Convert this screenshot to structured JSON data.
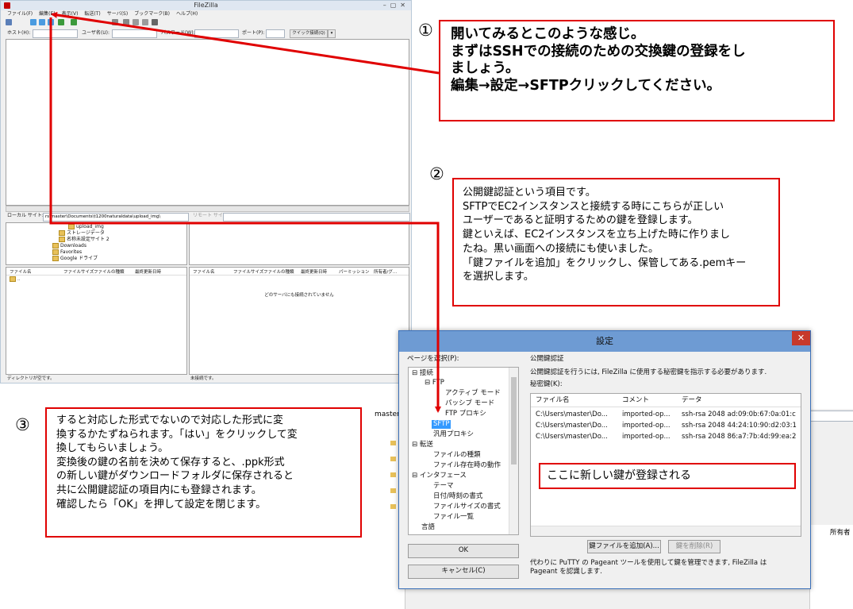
{
  "filezilla": {
    "title": "FileZilla",
    "menu": [
      "ファイル(F)",
      "編集(E)",
      "表示(V)",
      "転送(T)",
      "サーバ(S)",
      "ブックマーク(B)",
      "ヘルプ(H)"
    ],
    "quickconnect": {
      "host_label": "ホスト(H):",
      "user_label": "ユーザ名(U):",
      "password_label": "パスワード(W):",
      "port_label": "ポート(P):",
      "connect_button": "クイック接続(Q)"
    },
    "local_site_label": "ローカル サイト:",
    "local_site_path": "rs\\master\\Documents\\t1200naturaldata\\upload_img\\",
    "remote_site_label": "リモート サイト:",
    "local_tree": [
      "upload_img",
      "ストレージデータ",
      "名称未設定サイト 2",
      "Downloads",
      "Favorites",
      "Google ドライブ"
    ],
    "local_columns": [
      "ファイル名",
      "ファイルサイズ",
      "ファイルの種類",
      "最終更新日時"
    ],
    "local_first_row": "..",
    "remote_columns": [
      "ファイル名",
      "ファイルサイズ",
      "ファイルの種類",
      "最終更新日時",
      "パーミッション",
      "所有者/グ..."
    ],
    "remote_message": "どのサーバにも接続されていません",
    "local_status": "ディレクトリが空です。",
    "remote_status": "未接続です。"
  },
  "callout1": {
    "number": "①",
    "lines": [
      "開いてみるとこのような感じ。",
      "まずはSSHでの接続のための交換鍵の登録をし",
      "ましょう。",
      "編集→設定→SFTPクリックしてください。"
    ]
  },
  "callout2": {
    "number": "②",
    "lines": [
      "公開鍵認証という項目です。",
      "SFTPでEC2インスタンスと接続する時にこちらが正しい",
      "ユーザーであると証明するための鍵を登録します。",
      "鍵といえば、EC2インスタンスを立ち上げた時に作りまし",
      "たね。黒い画面への接続にも使いました。",
      "「鍵ファイルを追加」をクリックし、保管してある.pemキー",
      "を選択します。"
    ]
  },
  "callout3": {
    "number": "③",
    "lines": [
      "すると対応した形式でないので対応した形式に変",
      "換するかたずねられます。「はい」をクリックして変",
      "換してもらいましょう。",
      "変換後の鍵の名前を決めて保存すると、.ppk形式",
      "の新しい鍵がダウンロードフォルダに保存されると",
      "共に公開鍵認証の項目内にも登録されます。",
      "確認したら「OK」を押して設定を閉じます。"
    ]
  },
  "background_window": {
    "path_fragment": "master",
    "column": "所有者"
  },
  "settings": {
    "title": "設定",
    "close": "✕",
    "page_select_label": "ページを選択(P):",
    "tree": [
      "接続",
      "FTP",
      "アクティブ モード",
      "パッシブ モード",
      "FTP プロキシ",
      "SFTP",
      "汎用プロキシ",
      "転送",
      "ファイルの種類",
      "ファイル存在時の動作",
      "インタフェース",
      "テーマ",
      "日付/時刻の書式",
      "ファイルサイズの書式",
      "ファイル一覧",
      "言語"
    ],
    "ok_button": "OK",
    "cancel_button": "キャンセル(C)",
    "section_title": "公開鍵認証",
    "description": "公開鍵認証を行うには, FileZilla に使用する秘密鍵を指示する必要があります.",
    "private_keys_label": "秘密鍵(K):",
    "key_columns": [
      "ファイル名",
      "コメント",
      "データ"
    ],
    "keys": [
      {
        "file": "C:\\Users\\master\\Do...",
        "comment": "imported-op...",
        "data": "ssh-rsa 2048 ad:09:0b:67:0a:01:c"
      },
      {
        "file": "C:\\Users\\master\\Do...",
        "comment": "imported-op...",
        "data": "ssh-rsa 2048 44:24:10:90:d2:03:1"
      },
      {
        "file": "C:\\Users\\master\\Do...",
        "comment": "imported-op...",
        "data": "ssh-rsa 2048 86:a7:7b:4d:99:ea:2"
      }
    ],
    "key_note": "ここに新しい鍵が登録される",
    "add_key_button": "鍵ファイルを追加(A)...",
    "remove_key_button": "鍵を削除(R)",
    "pageant_note": [
      "代わりに PuTTY の Pageant ツールを使用して鍵を管理できます, FileZilla は",
      "Pageant を認識します."
    ]
  },
  "colors": {
    "callout_border": "#e00000",
    "arrow": "#e00000",
    "dialog_title": "#6e9bd3",
    "selected": "#3399ff"
  }
}
